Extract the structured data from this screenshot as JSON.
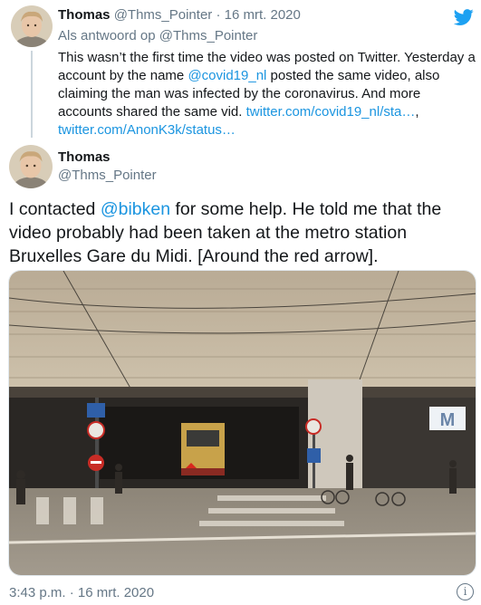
{
  "reply_tweet": {
    "author_name": "Thomas",
    "author_handle": "@Thms_Pointer",
    "separator": "·",
    "date": "16 mrt. 2020",
    "reply_prefix": "Als antwoord op",
    "reply_handle": "@Thms_Pointer",
    "text_1": "This wasn’t the first time the video was posted on Twitter. Yesterday a account by the name ",
    "mention": "@covid19_nl",
    "text_2": " posted the same video, also claiming the man was infected by the coronavirus. And more accounts shared the same vid. ",
    "link_1": "twitter.com/covid19_nl/sta…",
    "link_sep": ", ",
    "link_2": "twitter.com/AnonK3k/status…",
    "avatar_icon": "profile-avatar"
  },
  "main_tweet": {
    "author_name": "Thomas",
    "author_handle": "@Thms_Pointer",
    "text_1": "I contacted ",
    "mention": "@bibken",
    "text_2": " for some help. He told me that the video probably had been taken at the metro station Bruxelles Gare du Midi. [Around the red arrow].",
    "photo_alt": "Street view of metro station entrance",
    "timestamp": "3:43 p.m. · 16 mrt. 2020"
  },
  "icons": {
    "brand": "twitter-bird-icon",
    "info": "info-icon",
    "info_glyph": "i"
  },
  "colors": {
    "link": "#1b95e0",
    "muted": "#657786",
    "brand": "#1da1f2",
    "text": "#14171a"
  }
}
